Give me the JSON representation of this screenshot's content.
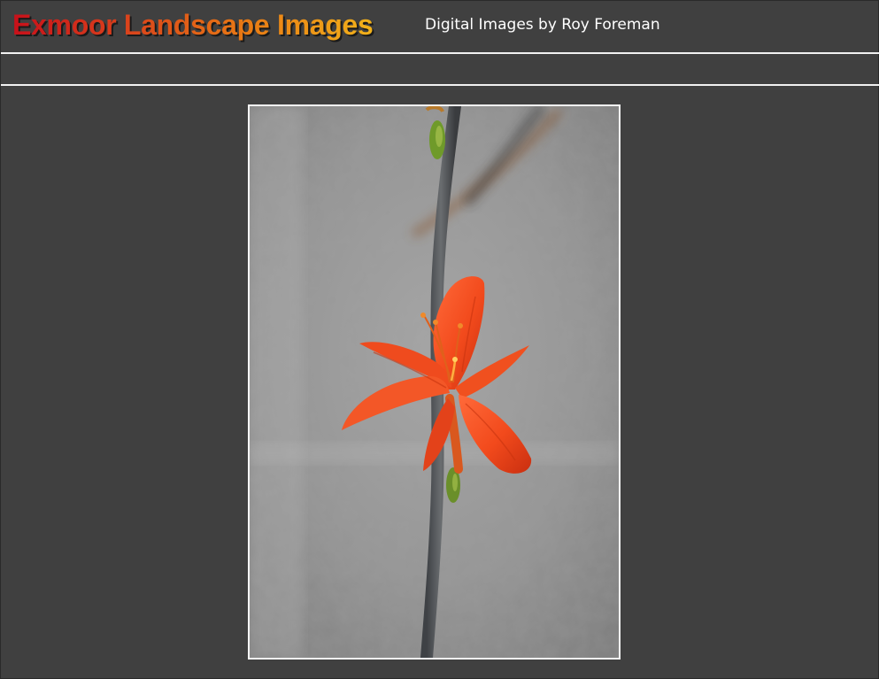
{
  "header": {
    "site_title": "Exmoor Landscape Images",
    "subtitle": "Digital Images by Roy Foreman"
  },
  "nav": {
    "items": []
  },
  "main": {
    "photo": {
      "subject": "photo-icon"
    }
  },
  "colors": {
    "background": "#404040",
    "rule": "#f2f2f2",
    "title_gradient_start": "#c8101a",
    "title_gradient_end": "#f2b21a",
    "subtitle": "#ffffff",
    "photo_border": "#f5f5f5"
  }
}
